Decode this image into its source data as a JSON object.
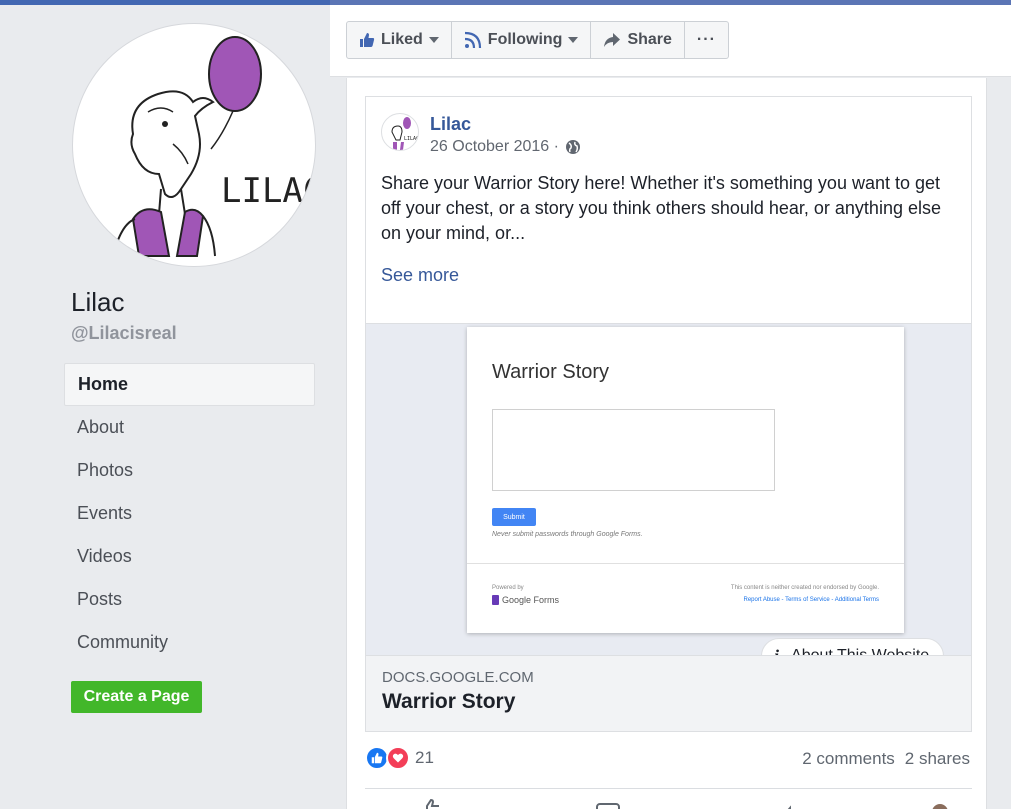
{
  "page": {
    "name": "Lilac",
    "handle": "@Lilacisreal",
    "avatar_text": "LILAC"
  },
  "sidebar": {
    "items": [
      {
        "label": "Home",
        "active": true
      },
      {
        "label": "About"
      },
      {
        "label": "Photos"
      },
      {
        "label": "Events"
      },
      {
        "label": "Videos"
      },
      {
        "label": "Posts"
      },
      {
        "label": "Community"
      }
    ],
    "create_page_label": "Create a Page"
  },
  "action_bar": {
    "liked_label": "Liked",
    "following_label": "Following",
    "share_label": "Share",
    "more_label": "···"
  },
  "post": {
    "author": "Lilac",
    "date": "26 October 2016 ·",
    "text": "Share your Warrior Story here! Whether it's something you want to get off your chest, or a story you think others should hear, or anything else on your mind, or...",
    "see_more": "See more",
    "link": {
      "domain": "DOCS.GOOGLE.COM",
      "title": "Warrior Story",
      "about_website": "About This Website"
    },
    "form_preview": {
      "title": "Warrior Story",
      "submit": "Submit",
      "note": "Never submit passwords through Google Forms.",
      "powered_by": "Powered by",
      "google_forms": "Google Forms",
      "disclaimer": "This content is neither created nor endorsed by Google.",
      "links": "Report Abuse - Terms of Service - Additional Terms"
    },
    "reaction_count": "21",
    "comments": "2 comments",
    "shares": "2 shares"
  },
  "colors": {
    "link_blue": "#365899",
    "brand_blue": "#4267b2",
    "create_green": "#42b72a",
    "lilac_purple": "#a056b6"
  }
}
